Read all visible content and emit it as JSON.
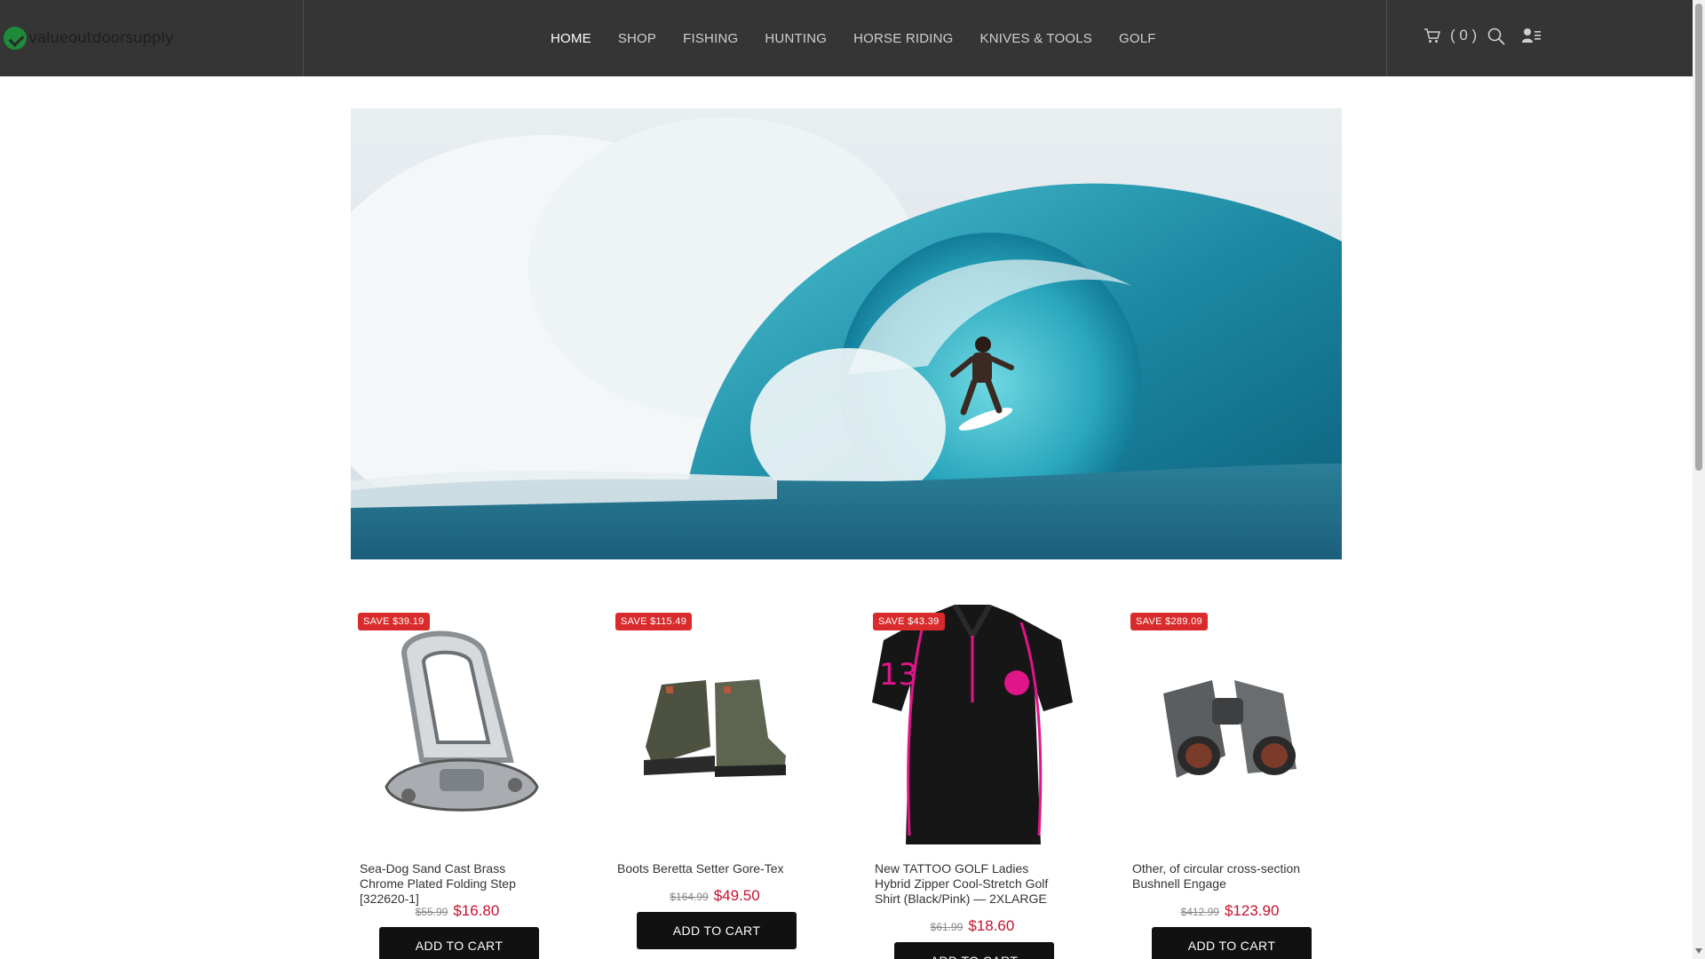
{
  "brand": {
    "name": "valueoutdoorsupply"
  },
  "nav": {
    "items": [
      "HOME",
      "SHOP",
      "FISHING",
      "HUNTING",
      "HORSE RIDING",
      "KNIVES & TOOLS",
      "GOLF"
    ],
    "active": "HOME"
  },
  "utility": {
    "cart_count": "( 0 )",
    "icons": [
      "cart-icon",
      "search-icon",
      "account-icon"
    ]
  },
  "hero": {
    "alt_subject": "surfer riding inside a large barrel wave"
  },
  "products": [
    {
      "badge": "SAVE $39.19",
      "title": "Sea-Dog Sand Cast Brass Chrome Plated Folding Step [322620-1]",
      "old_price": "$55.99",
      "price": "$16.80",
      "button": "ADD TO CART"
    },
    {
      "badge": "SAVE $115.49",
      "title": "Boots Beretta Setter Gore-Tex",
      "old_price": "$164.99",
      "price": "$49.50",
      "button": "ADD TO CART"
    },
    {
      "badge": "SAVE $43.39",
      "title": "New TATTOO GOLF Ladies Hybrid Zipper Cool-Stretch Golf Shirt (Black/Pink) — 2XLARGE",
      "old_price": "$61.99",
      "price": "$18.60",
      "button": "ADD TO CART"
    },
    {
      "badge": "SAVE $289.09",
      "title": "Other, of circular cross-section Bushnell Engage",
      "old_price": "$412.99",
      "price": "$123.90",
      "button": "ADD TO CART"
    }
  ],
  "colors": {
    "header_bg": "#353535",
    "badge_bg": "#d92b2b",
    "price": "#c8102e",
    "button_bg": "#111111"
  }
}
